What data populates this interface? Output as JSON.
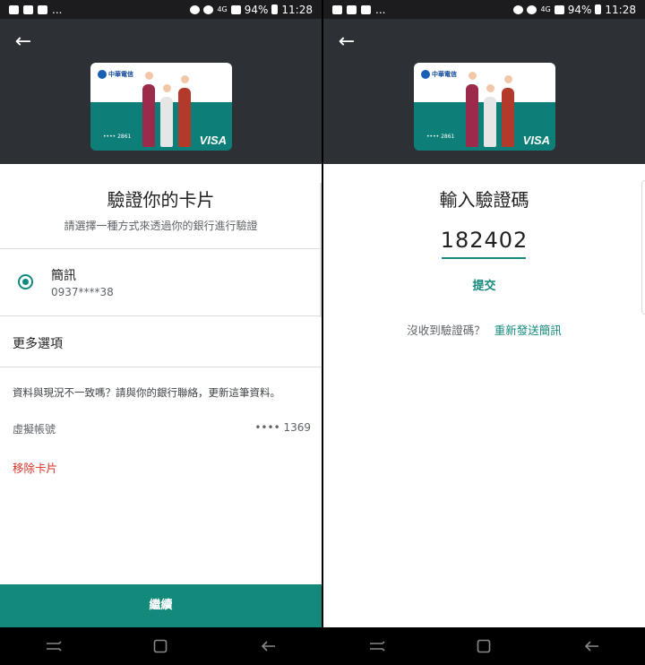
{
  "status_bar": {
    "battery": "94%",
    "time": "11:28",
    "left_dots": "...",
    "network": "4G"
  },
  "card": {
    "brand": "中華電信",
    "number_suffix": "•••• 2861",
    "network": "VISA"
  },
  "left": {
    "title": "驗證你的卡片",
    "subtitle": "請選擇一種方式來透過你的銀行進行驗證",
    "option": {
      "title": "簡訊",
      "value": "0937****38",
      "selected": true
    },
    "more_options": "更多選項",
    "info": "資料與現況不一致嗎？請與你的銀行聯絡，更新這筆資料。",
    "virtual_account_label": "虛擬帳號",
    "virtual_account_value": "•••• 1369",
    "remove_card": "移除卡片",
    "continue": "繼續"
  },
  "right": {
    "title": "輸入驗證碼",
    "code": "182402",
    "submit": "提交",
    "not_received": "沒收到驗證碼？",
    "resend": "重新發送簡訊"
  },
  "colors": {
    "accent": "#13897b",
    "header_bg": "#2d3136",
    "danger": "#d93025"
  },
  "icons": {
    "back": "back-arrow-icon",
    "nav_recent": "recent-apps-icon",
    "nav_home": "home-icon",
    "nav_back": "back-icon"
  }
}
